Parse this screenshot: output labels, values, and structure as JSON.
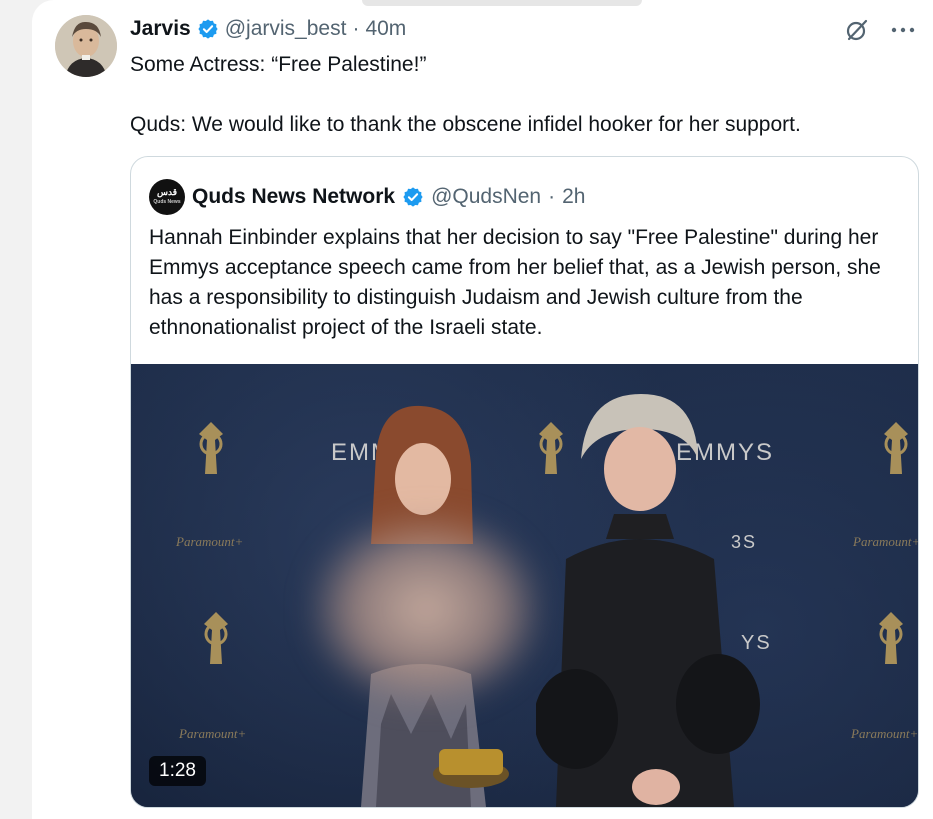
{
  "tweet": {
    "author_name": "Jarvis",
    "author_handle": "@jarvis_best",
    "separator": "·",
    "time": "40m",
    "line1": "Some Actress:  “Free Palestine!”",
    "line2": "Quds:  We would like to thank the obscene infidel hooker for her support."
  },
  "quoted": {
    "logo_text": "قدس",
    "logo_sub": "Quds News",
    "author_name": "Quds News Network",
    "author_handle": "@QudsNen",
    "separator": "·",
    "time": "2h",
    "text": "Hannah Einbinder explains that her decision to say \"Free Palestine\" during her Emmys acceptance speech came from her belief that, as a Jewish person, she has a responsibility to distinguish Judaism and Jewish culture from the ethnonationalist project of the Israeli state.",
    "media": {
      "backdrop_text_1": "EMM",
      "backdrop_text_2": "EMMYS",
      "backdrop_text_3": "3S",
      "backdrop_text_4": "YS",
      "watermark": "Paramount+",
      "duration": "1:28"
    }
  },
  "icons": {
    "verified": "verified-badge-icon",
    "grok": "slashed-circle-icon",
    "more": "more-icon"
  },
  "colors": {
    "verified": "#1d9bf0",
    "muted_text": "#536471",
    "text": "#0f1419",
    "border": "#cfd9de"
  }
}
